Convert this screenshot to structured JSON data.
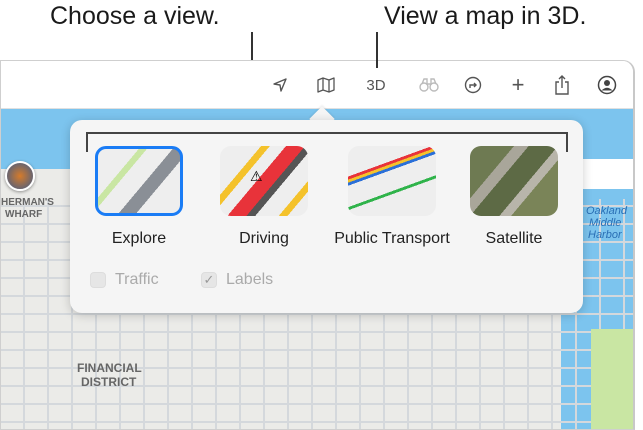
{
  "callouts": {
    "choose_view": "Choose a view.",
    "view_3d": "View a map in 3D."
  },
  "toolbar": {
    "location": "location-arrow",
    "map": "map",
    "threed": "3D",
    "look_around": "binoculars",
    "directions": "directions",
    "add": "+",
    "share": "share",
    "account": "account"
  },
  "popover": {
    "options": [
      {
        "label": "Explore",
        "selected": true
      },
      {
        "label": "Driving",
        "selected": false
      },
      {
        "label": "Public Transport",
        "selected": false
      },
      {
        "label": "Satellite",
        "selected": false
      }
    ],
    "checkboxes": [
      {
        "label": "Traffic",
        "checked": false
      },
      {
        "label": "Labels",
        "checked": true
      }
    ]
  },
  "map_labels": {
    "wharf1": "HERMAN'S",
    "wharf2": "WHARF",
    "fin1": "FINANCIAL",
    "fin2": "DISTRICT",
    "oak1": "Oakland",
    "oak2": "Middle",
    "oak3": "Harbor"
  },
  "colors": {
    "accent": "#1a7cf5",
    "water": "#7cc4ee",
    "park": "#c9e6a3"
  }
}
